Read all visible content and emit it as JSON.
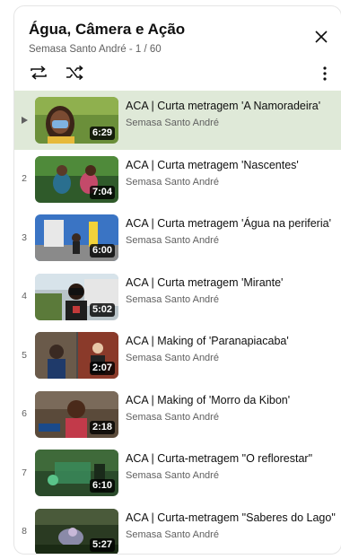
{
  "playlist": {
    "title": "Água, Câmera e Ação",
    "channel": "Semasa Santo André",
    "position": "1 / 60",
    "subtitle_separator": " - "
  },
  "icons": {
    "loop": "loop-icon",
    "shuffle": "shuffle-icon",
    "close": "close-icon",
    "more": "more-vert-icon",
    "now_playing": "play-arrow-icon"
  },
  "colors": {
    "active_row": "#dfe9d8",
    "secondary_text": "#606060"
  },
  "items": [
    {
      "index": "",
      "active": true,
      "title": "ACA | Curta metragem 'A Namoradeira'",
      "channel": "Semasa Santo André",
      "duration": "6:29"
    },
    {
      "index": "2",
      "active": false,
      "title": "ACA | Curta metragem 'Nascentes'",
      "channel": "Semasa Santo André",
      "duration": "7:04"
    },
    {
      "index": "3",
      "active": false,
      "title": "ACA | Curta metragem 'Água na periferia'",
      "channel": "Semasa Santo André",
      "duration": "6:00"
    },
    {
      "index": "4",
      "active": false,
      "title": "ACA | Curta metragem 'Mirante'",
      "channel": "Semasa Santo André",
      "duration": "5:02"
    },
    {
      "index": "5",
      "active": false,
      "title": "ACA | Making of 'Paranapiacaba'",
      "channel": "Semasa Santo André",
      "duration": "2:07"
    },
    {
      "index": "6",
      "active": false,
      "title": "ACA | Making of 'Morro da Kibon'",
      "channel": "Semasa Santo André",
      "duration": "2:18"
    },
    {
      "index": "7",
      "active": false,
      "title": "ACA | Curta-metragem \"O reflorestar\"",
      "channel": "Semasa Santo André",
      "duration": "6:10"
    },
    {
      "index": "8",
      "active": false,
      "title": "ACA | Curta-metragem \"Saberes do Lago\"",
      "channel": "Semasa Santo André",
      "duration": "5:27"
    }
  ]
}
